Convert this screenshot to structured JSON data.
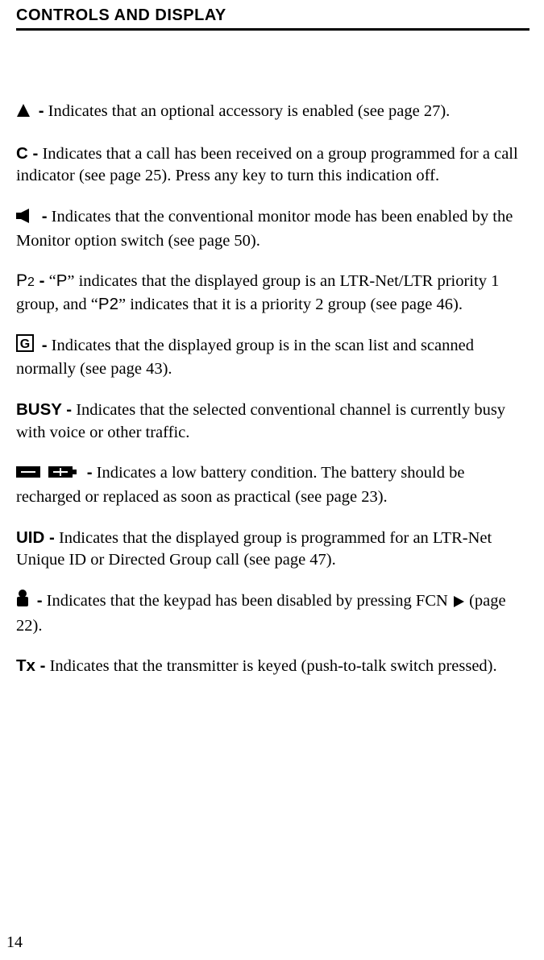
{
  "header": {
    "title": "CONTROLS AND DISPLAY"
  },
  "items": {
    "accessory": {
      "text": " Indicates that an optional accessory is enabled (see page 27)."
    },
    "c": {
      "lead": "C -",
      "text": " Indicates that a call has been received on a group programmed for a call indicator (see page 25). Press any key to turn this indication off."
    },
    "speaker": {
      "text": " Indicates that the conventional monitor mode has been enabled by the Monitor option switch (see page 50)."
    },
    "p2": {
      "t1": " “",
      "p1": "P",
      "t2": "” indicates that the displayed group is an LTR-Net/LTR priority 1 group, and “",
      "p2": "P2",
      "t3": "” indicates that it is a priority 2 group (see page 46)."
    },
    "g": {
      "text": " Indicates that the displayed group is in the scan list and scanned normally (see page 43)."
    },
    "busy": {
      "lead": "BUSY -",
      "text": " Indicates that the selected conventional channel is currently busy with voice or other traffic."
    },
    "battery": {
      "text": " Indicates a low battery condition. The battery should be recharged or replaced as soon as practical (see page 23)."
    },
    "uid": {
      "lead": "UID -",
      "text": " Indicates that the displayed group is programmed for an LTR-Net Unique ID or Directed Group call (see page 47)."
    },
    "lock": {
      "t1": " Indicates that the keypad has been disabled by pressing FCN ",
      "t2": " (page 22)."
    },
    "tx": {
      "lead": "Tx -",
      "text": " Indicates that the transmitter is keyed (push-to-talk switch pressed)."
    }
  },
  "page_number": "14"
}
